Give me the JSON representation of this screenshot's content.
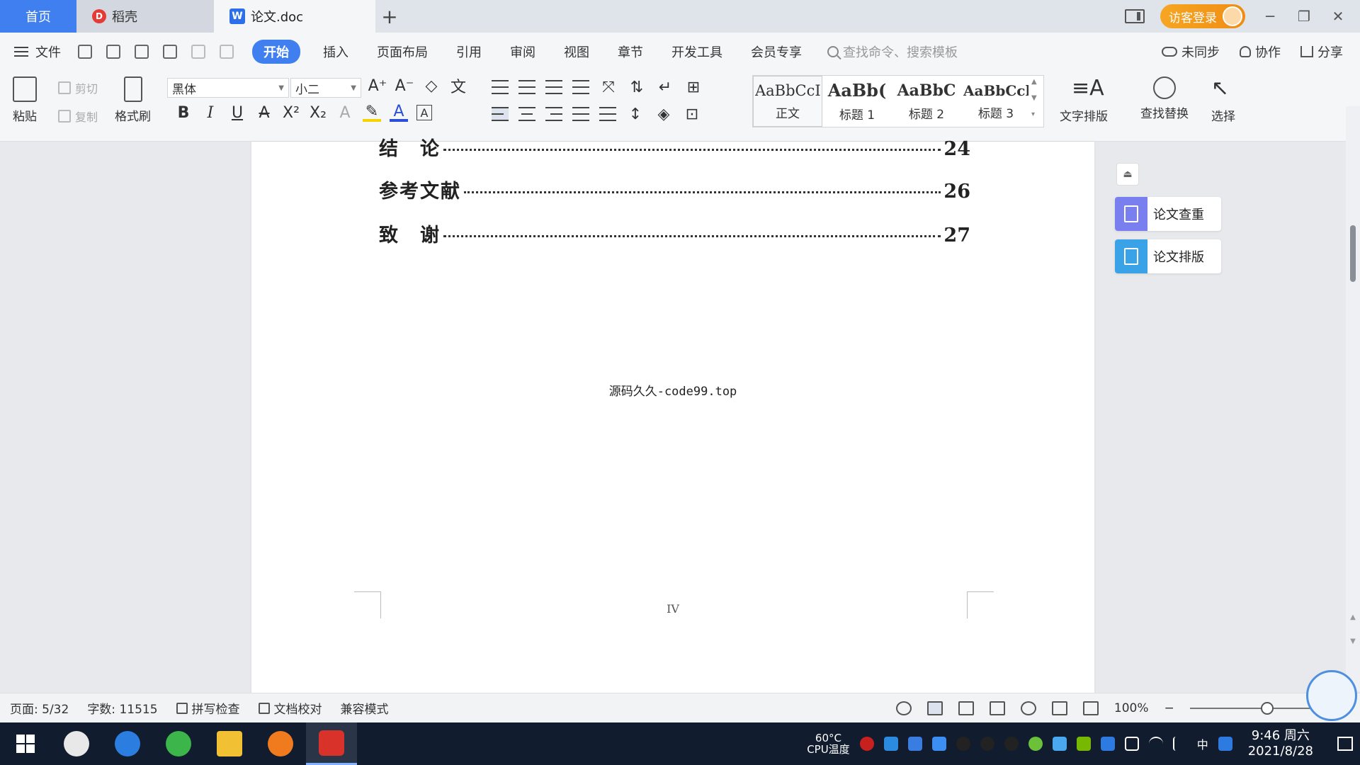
{
  "tabs": {
    "home": "首页",
    "daoke": "稻壳",
    "doc": "论文.doc",
    "add": "+"
  },
  "titlebar": {
    "visitor_login": "访客登录",
    "minimize": "─",
    "restore": "❐",
    "close": "✕"
  },
  "menubar": {
    "file": "文件",
    "menus": [
      "开始",
      "插入",
      "页面布局",
      "引用",
      "审阅",
      "视图",
      "章节",
      "开发工具",
      "会员专享"
    ],
    "search_placeholder": "查找命令、搜索模板",
    "unsynced": "未同步",
    "collab": "协作",
    "share": "分享"
  },
  "ribbon": {
    "paste": "粘贴",
    "cut": "剪切",
    "copy": "复制",
    "format_painter": "格式刷",
    "font": "黑体",
    "font_size": "小二",
    "styles": [
      {
        "preview": "AaBbCcI",
        "name": "正文"
      },
      {
        "preview": "AaBb(",
        "name": "标题 1"
      },
      {
        "preview": "AaBbC",
        "name": "标题 2"
      },
      {
        "preview": "AaBbCcl",
        "name": "标题 3"
      }
    ],
    "text_layout": "文字排版",
    "find_replace": "查找替换",
    "select": "选择"
  },
  "document": {
    "toc": [
      {
        "label": "结　论",
        "page": "24"
      },
      {
        "label": "参考文献",
        "page": "26"
      },
      {
        "label": "致　谢",
        "page": "27"
      }
    ],
    "footer_text": "源码久久-code99.top",
    "page_number": "IV"
  },
  "side_panel": {
    "check": "论文查重",
    "layout": "论文排版",
    "check_color": "#7a7ff0",
    "layout_color": "#3aa3e8"
  },
  "statusbar": {
    "page": "页面: 5/32",
    "words": "字数: 11515",
    "spell_check": "拼写检查",
    "doc_proof": "文档校对",
    "compat_mode": "兼容模式",
    "zoom": "100%",
    "zoom_minus": "−",
    "zoom_plus": "+"
  },
  "taskbar": {
    "cpu_temp": "60°C",
    "cpu_label": "CPU温度",
    "ime": "中",
    "time": "9:46 周六",
    "date": "2021/8/28"
  },
  "colors": {
    "accent": "#3f7ff0",
    "visitor": "#f6a623",
    "taskbar": "#111c2e"
  }
}
